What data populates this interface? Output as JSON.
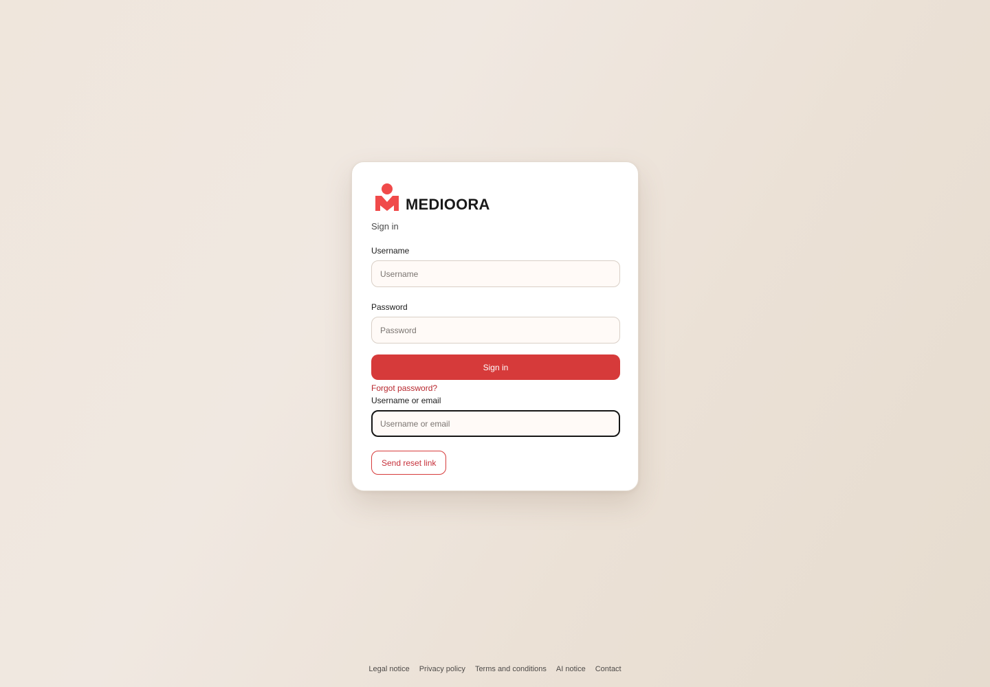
{
  "brand": {
    "name": "MEDIOORA",
    "logo_icon": "mediora-logo-icon",
    "logo_color": "#f04a4a"
  },
  "signin": {
    "subtitle": "Sign in",
    "username_label": "Username",
    "username_placeholder": "Username",
    "username_value": "",
    "password_label": "Password",
    "password_placeholder": "Password",
    "password_value": "",
    "submit_label": "Sign in",
    "forgot_link": "Forgot password?"
  },
  "reset": {
    "field_label": "Username or email",
    "placeholder": "Username or email",
    "value": "",
    "submit_label": "Send reset link"
  },
  "footer": {
    "links": [
      "Legal notice",
      "Privacy policy",
      "Terms and conditions",
      "AI notice",
      "Contact"
    ]
  },
  "colors": {
    "accent": "#d63a3a",
    "link": "#b8272d",
    "background": "#efe6dc"
  }
}
